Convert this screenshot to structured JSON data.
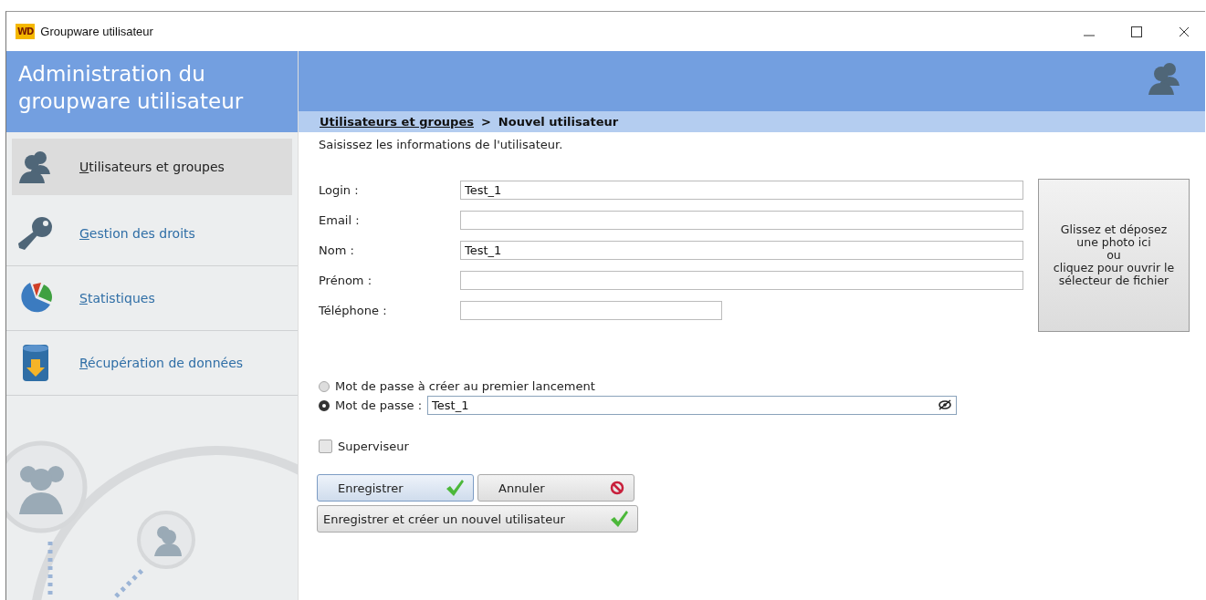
{
  "window": {
    "title": "Groupware utilisateur",
    "logo": "WD"
  },
  "header": {
    "title": "Administration du groupware utilisateur"
  },
  "breadcrumb": {
    "link": "Utilisateurs et groupes",
    "separator": ">",
    "current": "Nouvel utilisateur"
  },
  "sidebar": {
    "items": [
      {
        "label": "Utilisateurs et groupes",
        "selected": true
      },
      {
        "label": "Gestion des droits",
        "selected": false
      },
      {
        "label": "Statistiques",
        "selected": false
      },
      {
        "label": "Récupération de données",
        "selected": false
      }
    ]
  },
  "form": {
    "intro": "Saisissez les informations de l'utilisateur.",
    "fields": [
      {
        "label": "Login :",
        "value": "Test_1",
        "kind": "wide"
      },
      {
        "label": "Email :",
        "kind": "wide"
      },
      {
        "label": "Nom :",
        "value": "Test_1",
        "kind": "wide"
      },
      {
        "label": "Prénom :",
        "kind": "wide"
      },
      {
        "label": "Téléphone :",
        "kind": "short"
      }
    ],
    "photo_drop": {
      "lines": [
        "Glissez et déposez",
        "une photo ici",
        "ou",
        "cliquez pour ouvrir le",
        "sélecteur de fichier"
      ]
    },
    "password_options": [
      {
        "label": "Mot de passe à créer au premier lancement",
        "selected": false
      },
      {
        "label": "Mot de passe :",
        "selected": true,
        "value": "Test_1"
      }
    ],
    "supervisor": {
      "label": "Superviseur",
      "checked": false
    },
    "buttons": [
      {
        "label": "Enregistrer",
        "kind": "confirm",
        "default": true
      },
      {
        "label": "Annuler",
        "kind": "cancel",
        "default": false
      },
      {
        "label": "Enregistrer et créer un nouvel utilisateur",
        "kind": "confirm",
        "default": false
      }
    ]
  }
}
